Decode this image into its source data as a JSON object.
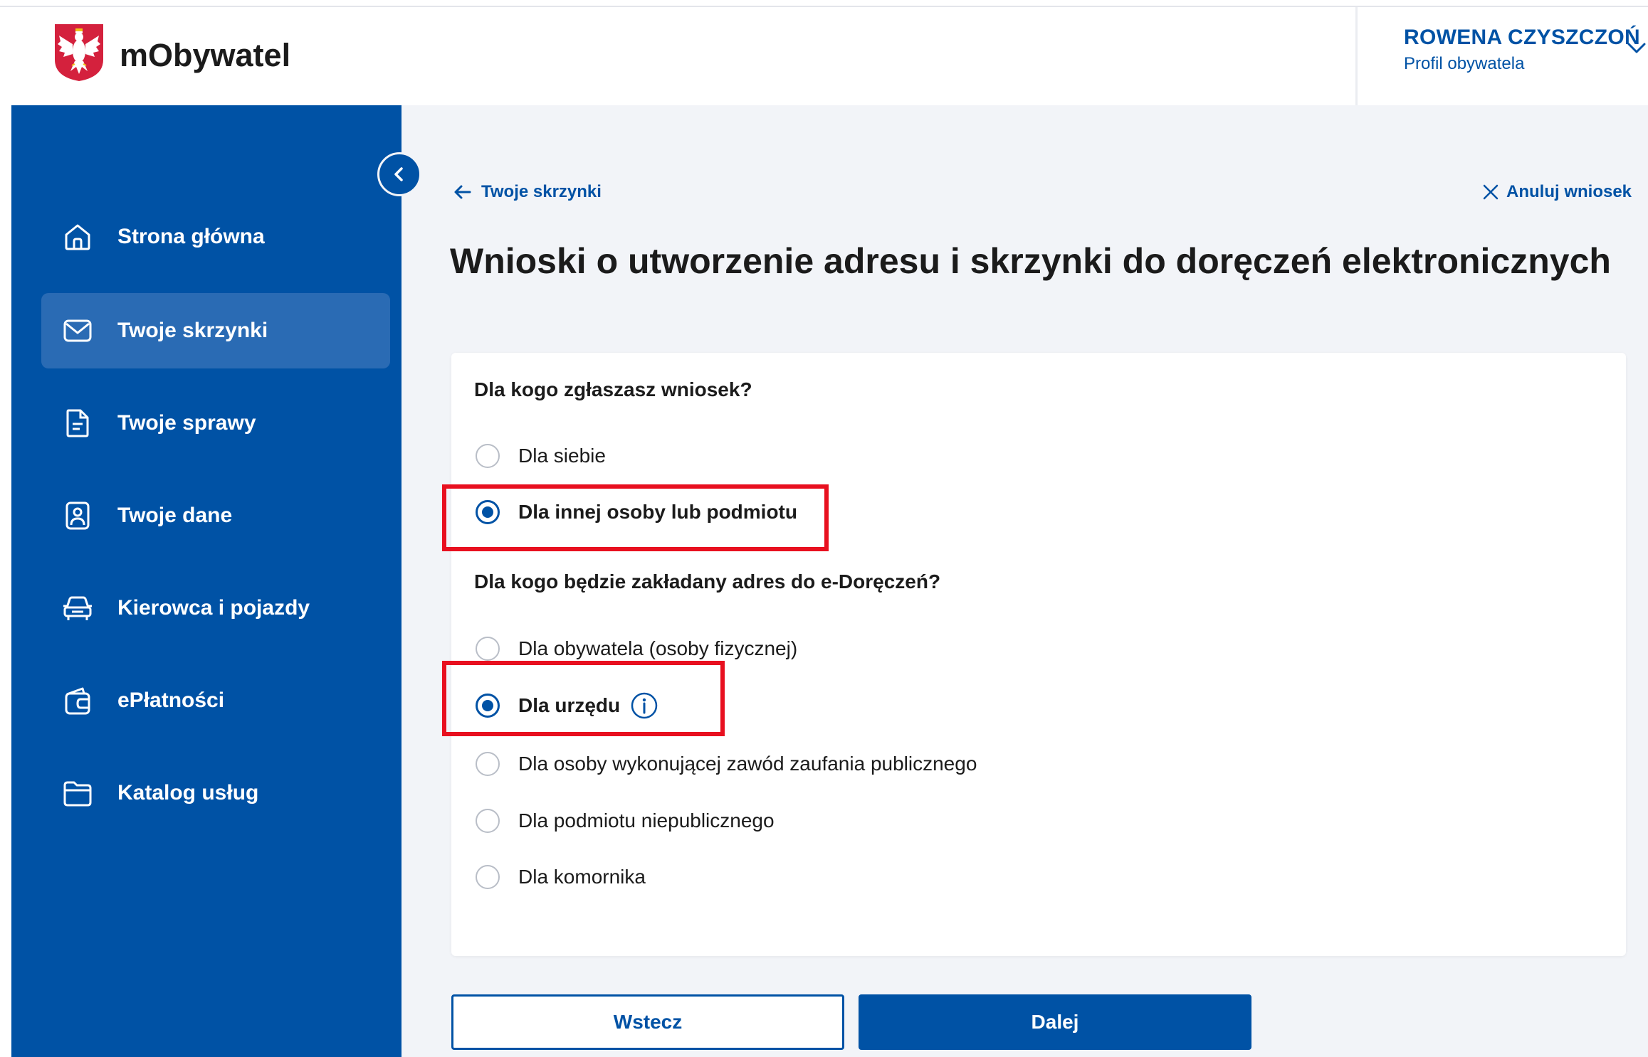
{
  "app": {
    "name": "mObywatel"
  },
  "user": {
    "name": "ROWENA CZYSZCZOŃ",
    "subtitle": "Profil obywatela"
  },
  "sidebar": {
    "items": [
      {
        "label": "Strona główna",
        "icon": "home-icon",
        "active": false
      },
      {
        "label": "Twoje skrzynki",
        "icon": "envelope-icon",
        "active": true
      },
      {
        "label": "Twoje sprawy",
        "icon": "document-icon",
        "active": false
      },
      {
        "label": "Twoje dane",
        "icon": "id-card-icon",
        "active": false
      },
      {
        "label": "Kierowca i pojazdy",
        "icon": "car-icon",
        "active": false
      },
      {
        "label": "ePłatności",
        "icon": "wallet-icon",
        "active": false
      },
      {
        "label": "Katalog usług",
        "icon": "folder-icon",
        "active": false
      }
    ]
  },
  "nav": {
    "back_label": "Twoje skrzynki",
    "cancel_label": "Anuluj wniosek"
  },
  "page": {
    "title": "Wnioski o utworzenie adresu i skrzynki do doręczeń elektronicznych"
  },
  "form": {
    "question1": {
      "label": "Dla kogo zgłaszasz wniosek?",
      "options": [
        {
          "label": "Dla siebie",
          "selected": false
        },
        {
          "label": "Dla innej osoby lub podmiotu",
          "selected": true
        }
      ]
    },
    "question2": {
      "label": "Dla kogo będzie zakładany adres do e-Doręczeń?",
      "options": [
        {
          "label": "Dla obywatela (osoby fizycznej)",
          "selected": false
        },
        {
          "label": "Dla urzędu",
          "selected": true,
          "info_icon": "info-icon"
        },
        {
          "label": "Dla osoby wykonującej zawód zaufania publicznego",
          "selected": false
        },
        {
          "label": "Dla podmiotu niepublicznego",
          "selected": false
        },
        {
          "label": "Dla komornika",
          "selected": false
        }
      ]
    }
  },
  "buttons": {
    "back": "Wstecz",
    "next": "Dalej"
  },
  "colors": {
    "primary": "#0052a5",
    "highlight": "#e8101f",
    "background": "#f2f4f8"
  }
}
